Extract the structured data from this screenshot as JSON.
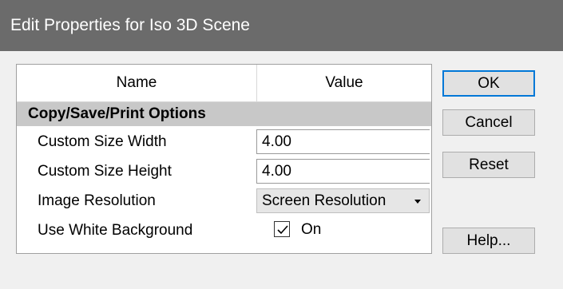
{
  "window": {
    "title": "Edit Properties for Iso 3D Scene"
  },
  "grid": {
    "col_name": "Name",
    "col_value": "Value",
    "category": "Copy/Save/Print Options",
    "rows": [
      {
        "name": "Custom Size Width",
        "value": "4.00"
      },
      {
        "name": "Custom Size Height",
        "value": "4.00"
      },
      {
        "name": "Image Resolution",
        "value": "Screen Resolution"
      },
      {
        "name": "Use White Background",
        "value": "On",
        "checked": true
      }
    ]
  },
  "buttons": {
    "ok": "OK",
    "cancel": "Cancel",
    "reset": "Reset",
    "help": "Help..."
  },
  "colors": {
    "titlebar": "#6b6b6b",
    "default_button_border": "#0078d7",
    "category_band": "#c8c8c8"
  }
}
